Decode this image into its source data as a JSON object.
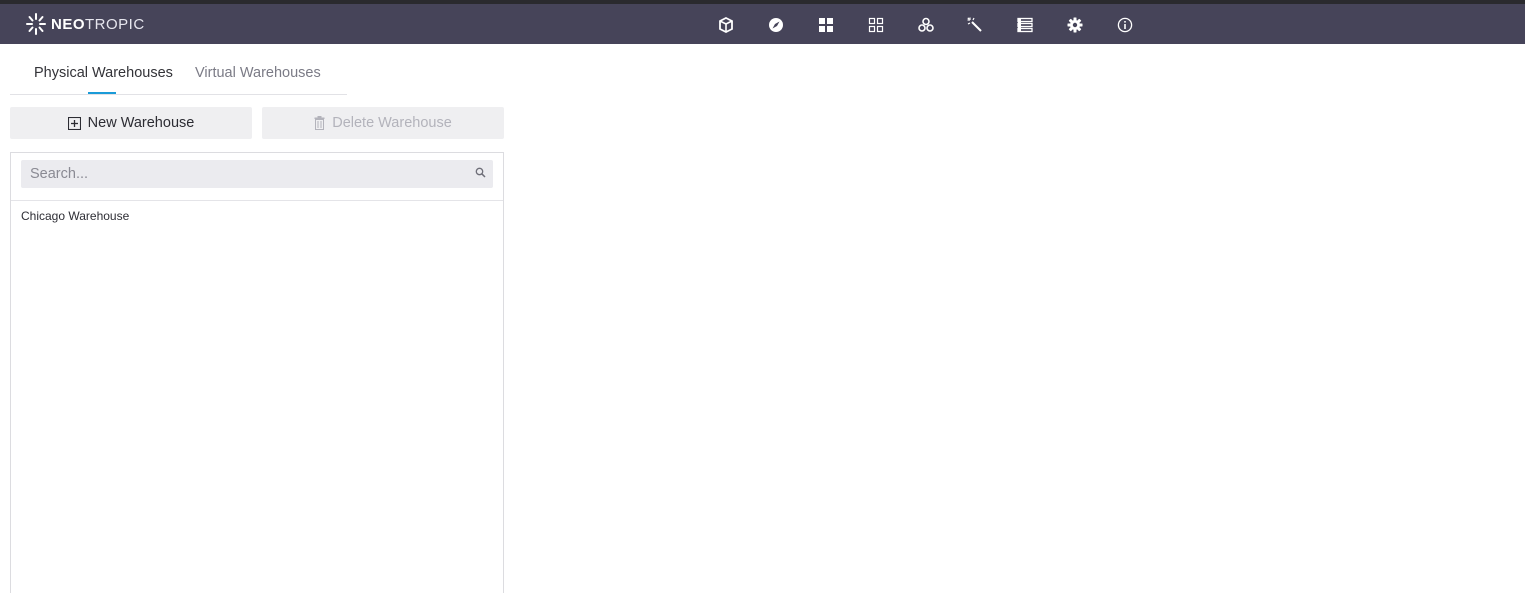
{
  "brand": {
    "name_bold": "NEO",
    "name_light": "TROPIC"
  },
  "nav": {
    "icons": [
      "cube-icon",
      "compass-icon",
      "dashboard-icon",
      "grid-icon",
      "network-icon",
      "magic-wand-icon",
      "list-icon",
      "gear-icon",
      "info-icon"
    ]
  },
  "tabs": {
    "physical": "Physical Warehouses",
    "virtual": "Virtual Warehouses"
  },
  "toolbar": {
    "new_label": "New Warehouse",
    "delete_label": "Delete Warehouse"
  },
  "search": {
    "placeholder": "Search..."
  },
  "warehouses": {
    "items": [
      "Chicago Warehouse"
    ]
  },
  "colors": {
    "topbar": "#464459",
    "accent": "#1a9bd8"
  }
}
